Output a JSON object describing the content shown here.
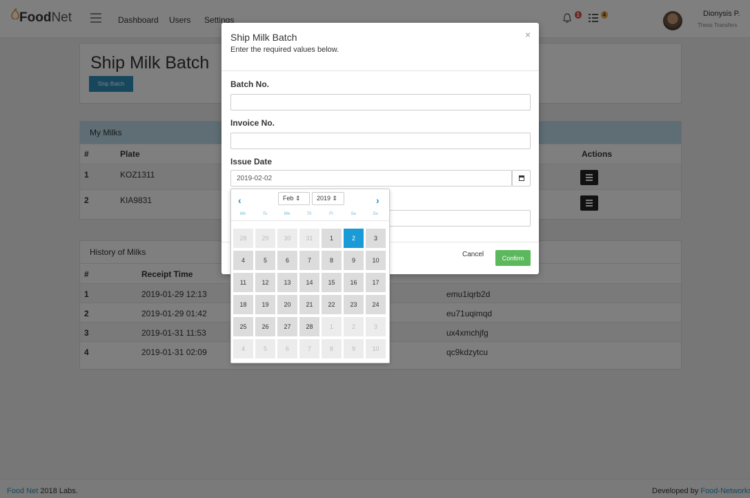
{
  "app": {
    "brand_bold": "Food",
    "brand_light": "Net",
    "nav": [
      "Dashboard",
      "Users",
      "Settings"
    ],
    "notif_count_1": "1",
    "notif_count_2": "4",
    "user_name": "Dionysis P.",
    "user_org": "Thess Transfers"
  },
  "page": {
    "title": "Ship Milk Batch",
    "ship_button": "Ship Batch"
  },
  "milks": {
    "heading": "My Milks",
    "columns": [
      "#",
      "Plate",
      "Actions"
    ],
    "rows": [
      {
        "num": "1",
        "plate": "KOZ1311"
      },
      {
        "num": "2",
        "plate": "KIA9831"
      }
    ]
  },
  "history": {
    "heading": "History of Milks",
    "columns": [
      "#",
      "Receipt Time"
    ],
    "rows": [
      {
        "num": "1",
        "time": "2019-01-29 12:13",
        "code": "emu1iqrb2d"
      },
      {
        "num": "2",
        "time": "2019-01-29 01:42",
        "code": "eu71uqimqd"
      },
      {
        "num": "3",
        "time": "2019-01-31 11:53",
        "code": "ux4xmchjfg"
      },
      {
        "num": "4",
        "time": "2019-01-31 02:09",
        "code": "qc9kdzytcu"
      }
    ]
  },
  "footer": {
    "left_link": "Food Net",
    "left_text": "2018 Labs.",
    "right_text": "Developed by",
    "right_link": "Food-Networks"
  },
  "modal": {
    "title": "Ship Milk Batch",
    "subtitle": "Enter the required values below.",
    "close": "×",
    "batch_label": "Batch No.",
    "batch_value": "",
    "invoice_label": "Invoice No.",
    "invoice_value": "",
    "date_label": "Issue Date",
    "date_value": "2019-02-02",
    "cancel": "Cancel",
    "confirm": "Confirm"
  },
  "picker": {
    "month": "Feb",
    "year": "2019",
    "prev": "‹",
    "next": "›",
    "weekdays": [
      "Mo",
      "Tu",
      "We",
      "Th",
      "Fr",
      "Sa",
      "Su"
    ],
    "weeks": [
      [
        "28",
        "29",
        "30",
        "31",
        "1",
        "2",
        "3"
      ],
      [
        "4",
        "5",
        "6",
        "7",
        "8",
        "9",
        "10"
      ],
      [
        "11",
        "12",
        "13",
        "14",
        "15",
        "16",
        "17"
      ],
      [
        "18",
        "19",
        "20",
        "21",
        "22",
        "23",
        "24"
      ],
      [
        "25",
        "26",
        "27",
        "28",
        "1",
        "2",
        "3"
      ],
      [
        "4",
        "5",
        "6",
        "7",
        "8",
        "9",
        "10"
      ]
    ],
    "selected": "2"
  },
  "colors": {
    "accent": "#2f8fba",
    "selected_day": "#1a9ad6",
    "confirm": "#5cb85c"
  }
}
